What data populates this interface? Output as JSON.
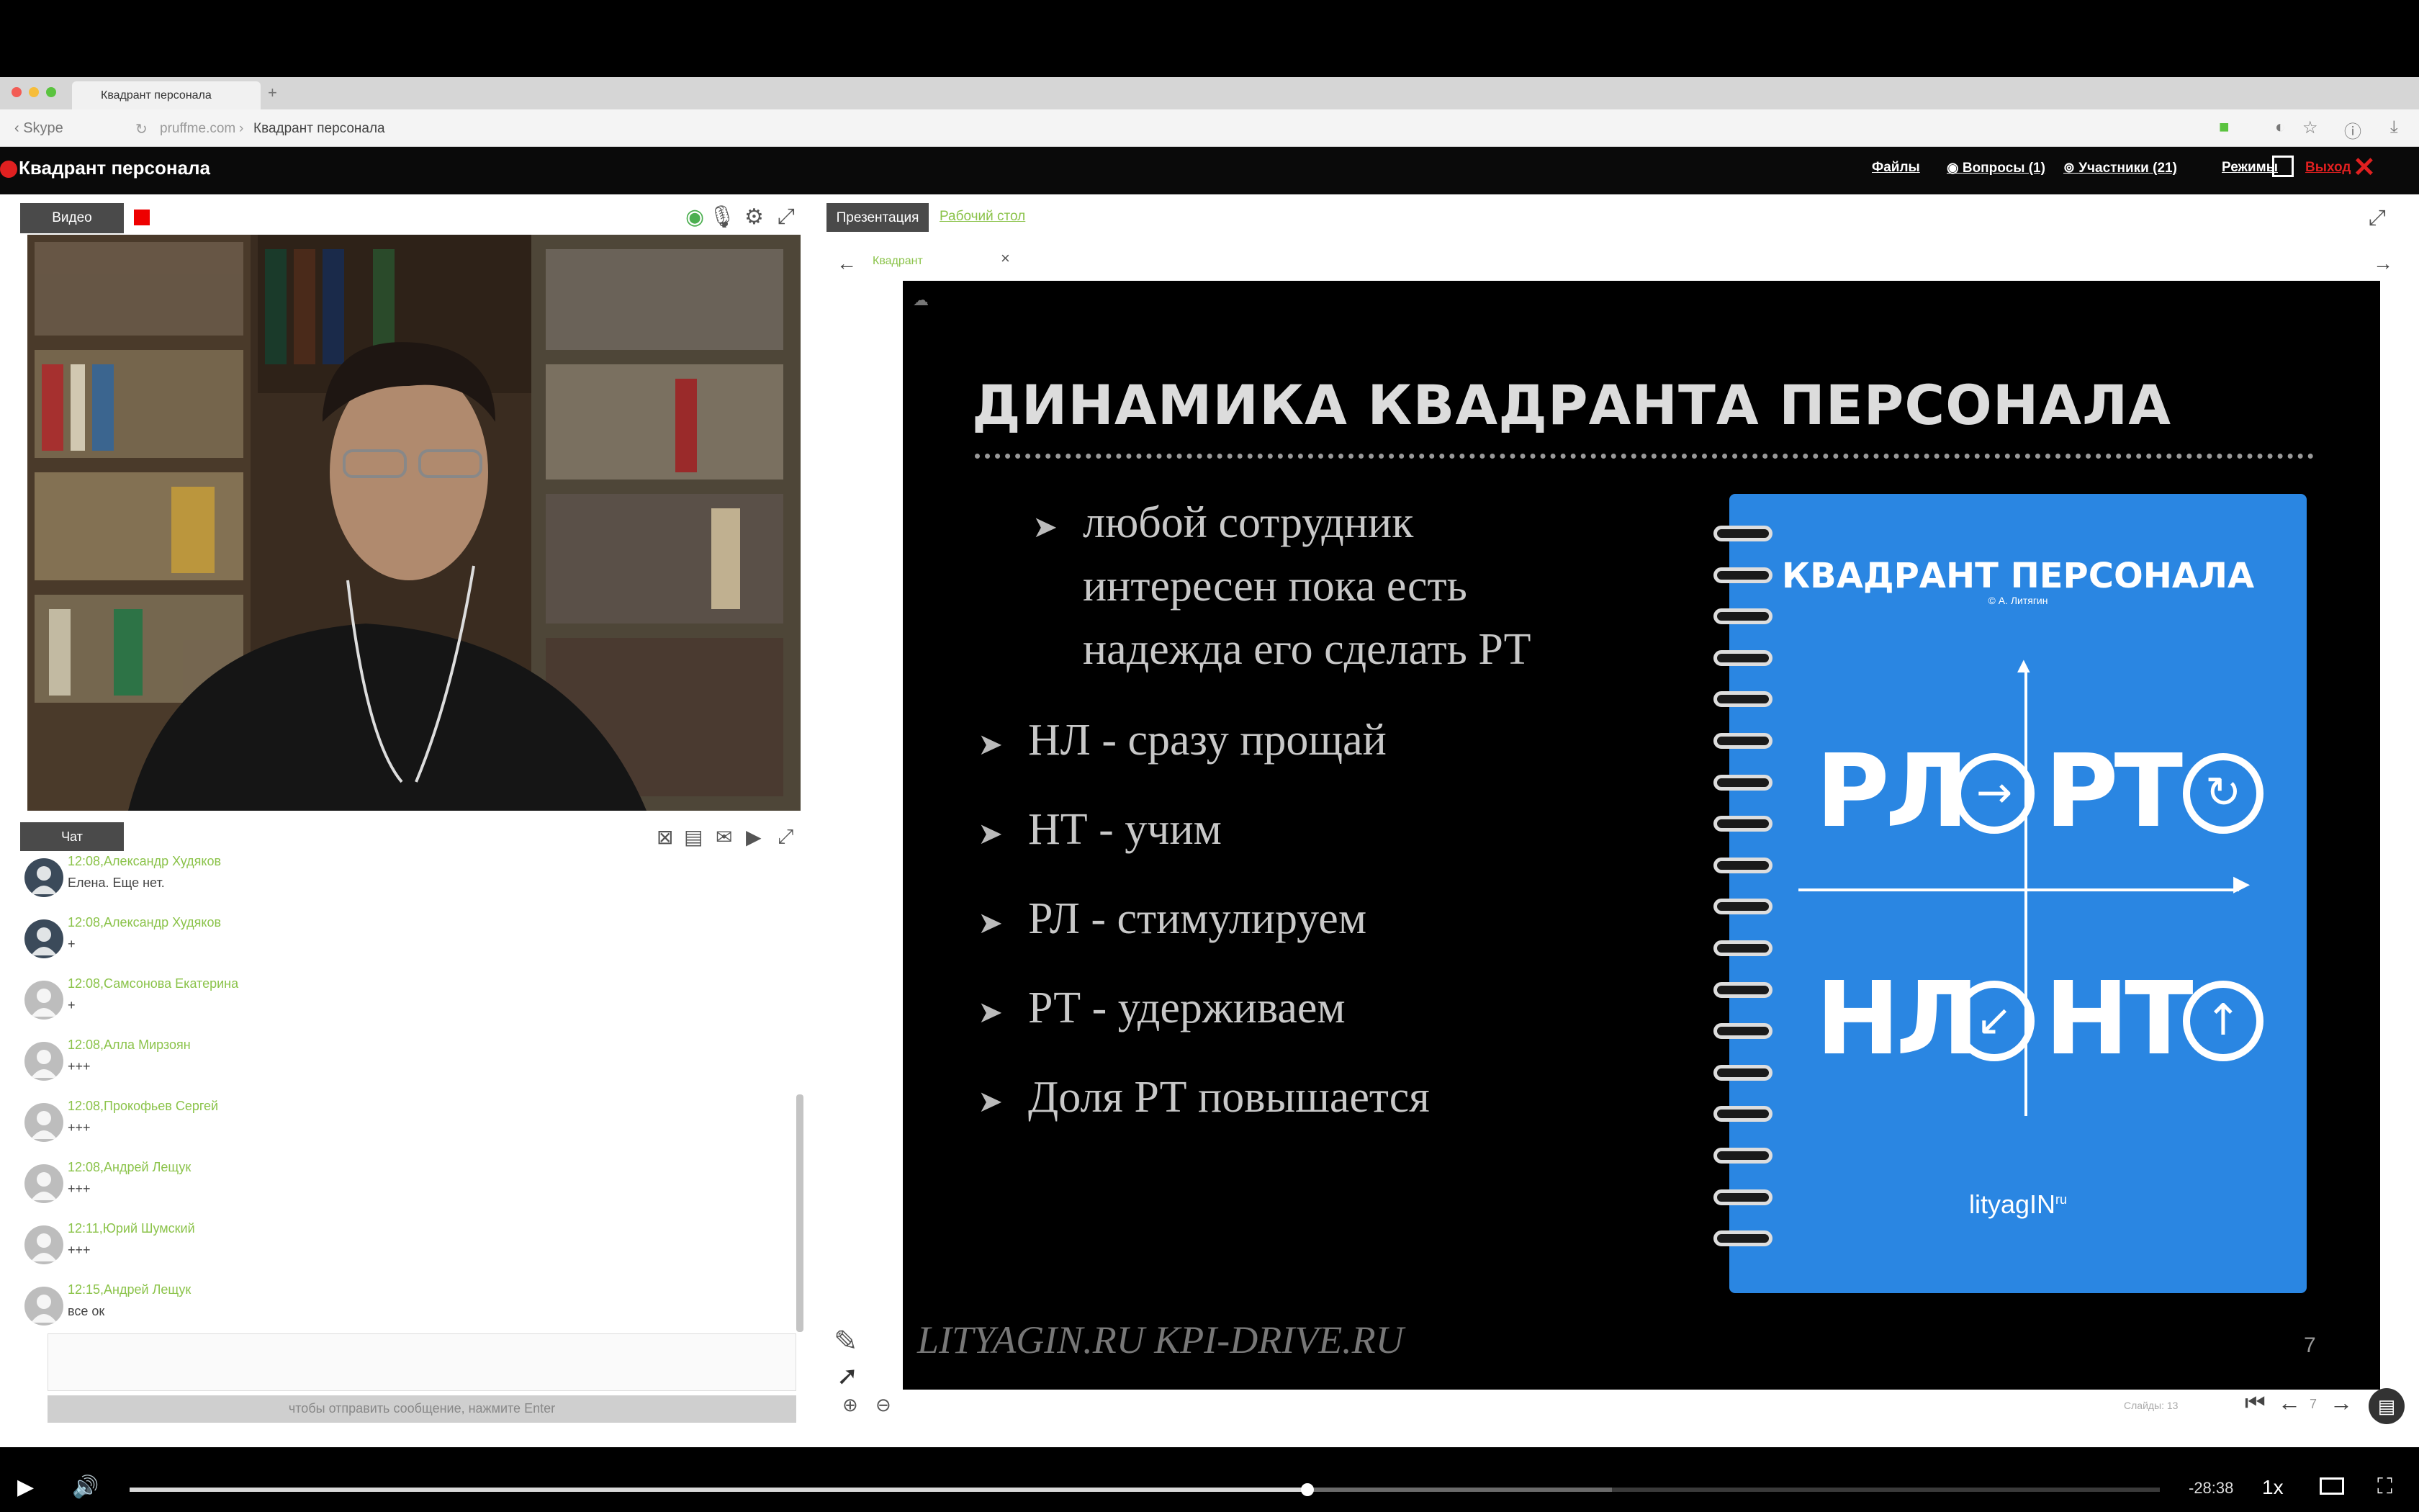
{
  "browser": {
    "tab_title": "Квадрант персонала",
    "new_tab": "+",
    "back_label": "‹ Skype",
    "url_domain": "pruffme.com",
    "url_separator": "›",
    "url_title": "Квадрант персонала"
  },
  "app": {
    "title": "Квадрант персонала",
    "files": "Файлы",
    "questions": "Вопросы (1)",
    "participants": "Участники (21)",
    "modes": "Режимы",
    "exit": "Выход"
  },
  "video_panel": {
    "tab": "Видео"
  },
  "chat": {
    "tab": "Чат",
    "messages": [
      {
        "meta": "12:08,Александр Худяков",
        "text": "Елена. Еще нет."
      },
      {
        "meta": "12:08,Александр Худяков",
        "text": "+"
      },
      {
        "meta": "12:08,Самсонова Екатерина",
        "text": "+"
      },
      {
        "meta": "12:08,Алла Мирзоян",
        "text": "+++"
      },
      {
        "meta": "12:08,Прокофьев Сергей",
        "text": "+++"
      },
      {
        "meta": "12:08,Андрей Лещук",
        "text": "+++"
      },
      {
        "meta": "12:11,Юрий Шумский",
        "text": "+++"
      },
      {
        "meta": "12:15,Андрей Лещук",
        "text": "все ок"
      }
    ],
    "hint": "чтобы отправить сообщение, нажмите Enter"
  },
  "presentation": {
    "tab": "Презентация",
    "desktop_link": "Рабочий стол",
    "doc_tab": "Квадрант",
    "slide": {
      "title": "ДИНАМИКА КВАДРАНТА ПЕРСОНАЛА",
      "bullets": [
        "любой сотрудник",
        "интересен пока есть",
        "надежда его сделать РТ",
        "НЛ - сразу прощай",
        "НТ - учим",
        "РЛ - стимулируем",
        "РТ - удерживаем",
        "Доля РТ повышается"
      ],
      "notebook_title": "КВАДРАНТ ПЕРСОНАЛА",
      "notebook_author": "© А. Литягин",
      "quadrants": {
        "rl": "РЛ",
        "rt": "РТ",
        "nl": "НЛ",
        "nt": "НТ"
      },
      "logo": "lityagIN",
      "logo_sup": "ru",
      "footer": "LITYAGIN.RU  KPI-DRIVE.RU",
      "number": "7"
    },
    "slides_counter": "Слайды: 13",
    "page": "7"
  },
  "player": {
    "time_left": "-28:38",
    "speed": "1x",
    "played_fraction": 0.58,
    "buffered_fraction": 0.73
  },
  "colors": {
    "accent_green": "#8bc34a",
    "record_red": "#e00000",
    "slide_blue": "#2a86e2"
  }
}
